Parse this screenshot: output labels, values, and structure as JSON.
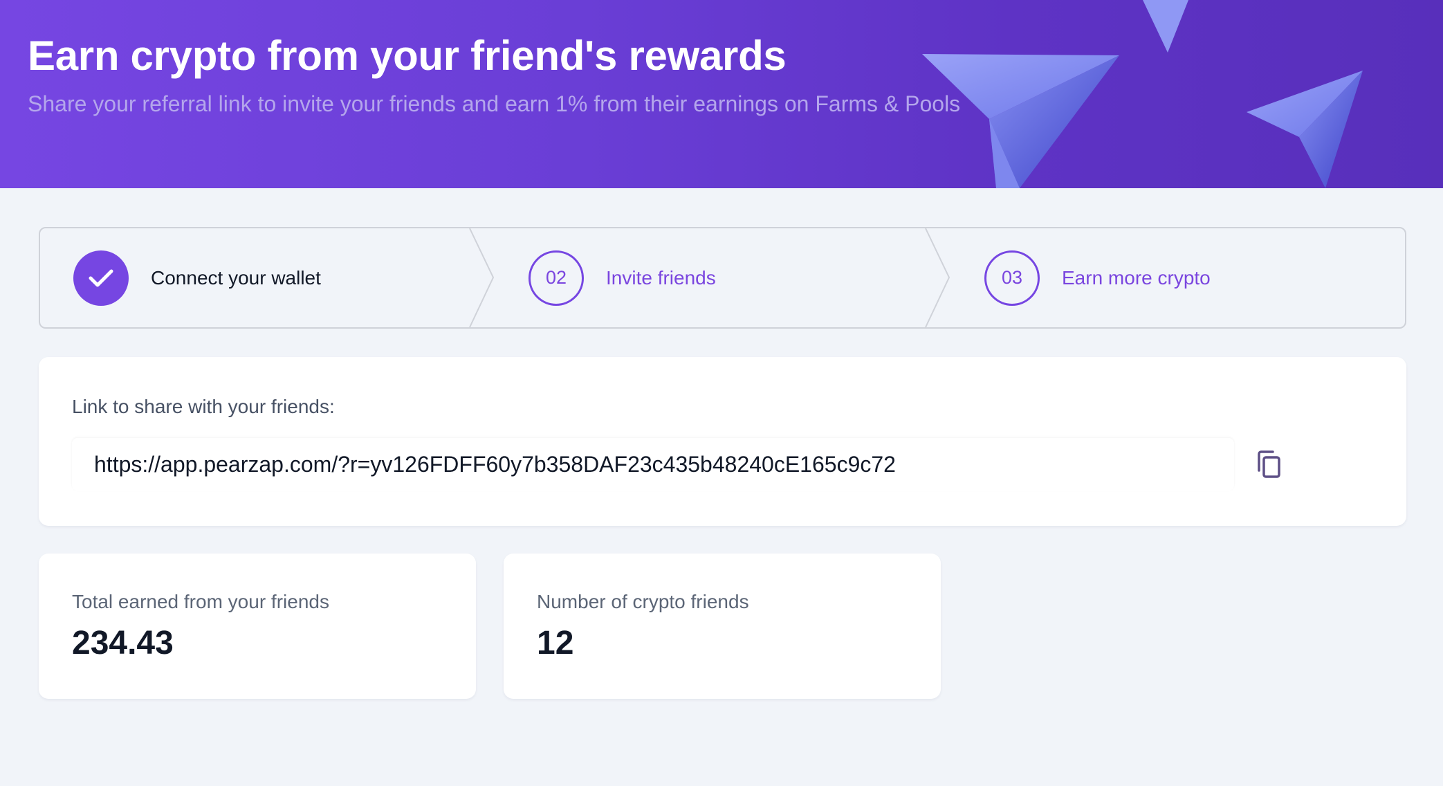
{
  "header": {
    "title": "Earn crypto from your friend's rewards",
    "subtitle": "Share your referral link to invite your friends and earn 1% from their earnings on Farms & Pools"
  },
  "steps": [
    {
      "number": "",
      "label": "Connect your wallet",
      "state": "completed",
      "icon": "check-icon"
    },
    {
      "number": "02",
      "label": "Invite friends",
      "state": "pending"
    },
    {
      "number": "03",
      "label": "Earn more crypto",
      "state": "pending"
    }
  ],
  "referral": {
    "label": "Link to share with your friends:",
    "link": "https://app.pearzap.com/?r=yv126FDFF60y7b358DAF23c435b48240cE165c9c72",
    "copy_icon": "copy-icon"
  },
  "stats": [
    {
      "label": "Total earned from your friends",
      "value": "234.43"
    },
    {
      "label": "Number of crypto friends",
      "value": "12"
    }
  ],
  "colors": {
    "accent": "#7646e2",
    "header_start": "#7646e2",
    "header_end": "#582fbb",
    "page_bg": "#f1f4f9"
  }
}
